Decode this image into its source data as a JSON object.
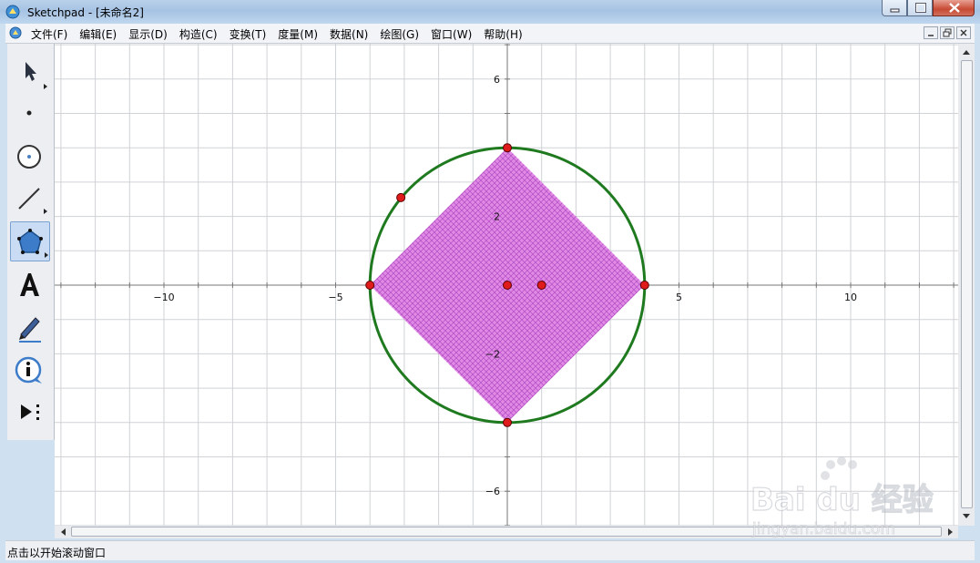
{
  "window": {
    "title": "Sketchpad  - [未命名2]"
  },
  "menu": {
    "items": [
      "文件(F)",
      "编辑(E)",
      "显示(D)",
      "构造(C)",
      "变换(T)",
      "度量(M)",
      "数据(N)",
      "绘图(G)",
      "窗口(W)",
      "帮助(H)"
    ]
  },
  "toolbox": {
    "tools": [
      {
        "name": "arrow-select-tool",
        "icon": "arrow-cursor-icon",
        "active": false
      },
      {
        "name": "point-tool",
        "icon": "point-icon",
        "active": false
      },
      {
        "name": "compass-tool",
        "icon": "circle-icon",
        "active": false
      },
      {
        "name": "straightedge-tool",
        "icon": "line-segment-icon",
        "active": false
      },
      {
        "name": "polygon-tool",
        "icon": "pentagon-icon",
        "active": true
      },
      {
        "name": "text-tool",
        "icon": "letter-a-icon",
        "active": false
      },
      {
        "name": "marker-tool",
        "icon": "marker-pen-icon",
        "active": false
      },
      {
        "name": "information-tool",
        "icon": "info-icon",
        "active": false
      },
      {
        "name": "custom-tool",
        "icon": "play-dots-icon",
        "active": false
      }
    ]
  },
  "graph": {
    "x_range": [
      -13,
      13
    ],
    "y_range": [
      -7,
      7
    ],
    "grid": true,
    "x_tick_labels": [
      {
        "value": -10,
        "label": "−10"
      },
      {
        "value": -5,
        "label": "−5"
      },
      {
        "value": 5,
        "label": "5"
      },
      {
        "value": 10,
        "label": "10"
      }
    ],
    "y_tick_labels": [
      {
        "value": 6,
        "label": "6"
      },
      {
        "value": 2,
        "label": "2"
      },
      {
        "value": -2,
        "label": "−2"
      },
      {
        "value": -6,
        "label": "−6"
      }
    ],
    "circle": {
      "center": [
        0,
        0
      ],
      "radius": 4,
      "color": "#1f7a1f"
    },
    "square": {
      "vertices": [
        [
          0,
          4
        ],
        [
          4,
          0
        ],
        [
          0,
          -4
        ],
        [
          -4,
          0
        ]
      ],
      "fill": "#e08ae6",
      "hatch": "#b14cc0"
    },
    "points": [
      {
        "name": "top-vertex",
        "x": 0,
        "y": 4
      },
      {
        "name": "right-vertex",
        "x": 4,
        "y": 0
      },
      {
        "name": "bottom-vertex",
        "x": 0,
        "y": -4
      },
      {
        "name": "left-vertex",
        "x": -4,
        "y": 0
      },
      {
        "name": "center",
        "x": 0,
        "y": 0
      },
      {
        "name": "unit-point",
        "x": 1,
        "y": 0
      },
      {
        "name": "circle-point",
        "x": -3.1,
        "y": 2.55
      }
    ],
    "point_color": "#e01b1b"
  },
  "status": {
    "text": "点击以开始滚动窗口"
  },
  "watermark": {
    "brand": "Bai du 经验",
    "url": "jingyan.baidu.com"
  }
}
